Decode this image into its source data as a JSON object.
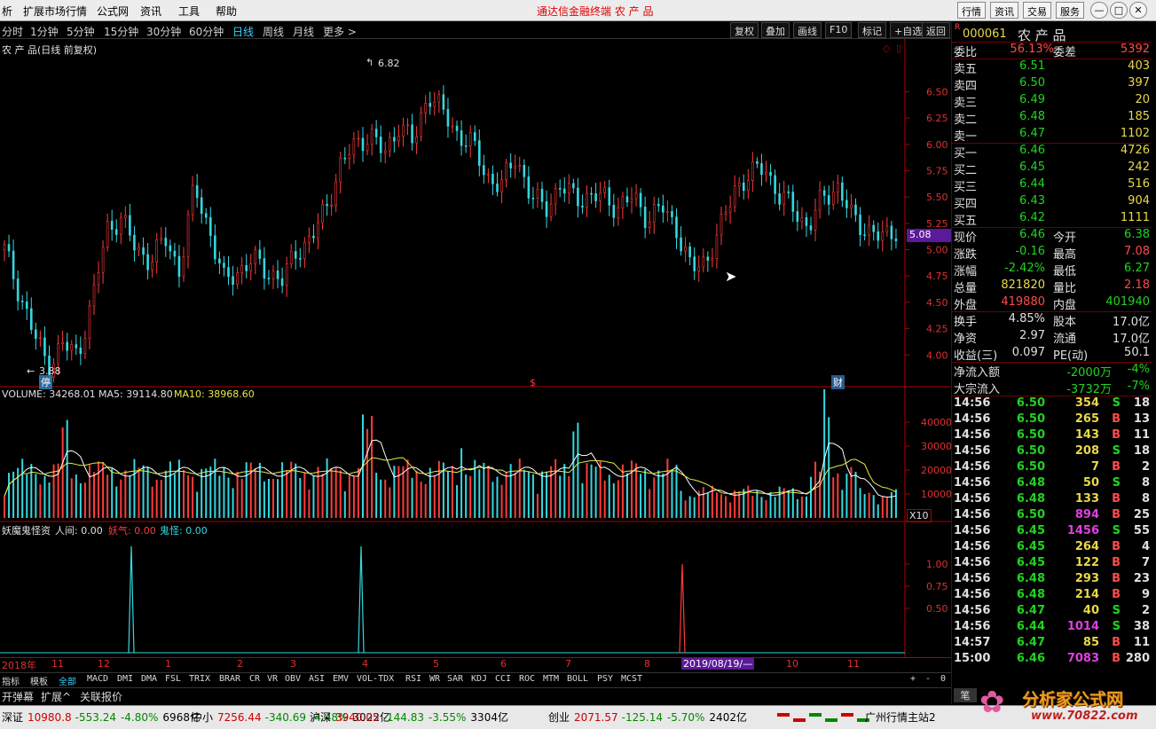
{
  "menubar": {
    "left_items": [
      "析",
      "扩展市场行情",
      "公式网",
      "资讯",
      "工具",
      "帮助"
    ],
    "title": "通达信金融终端  农 产 品",
    "right_buttons": [
      "行情",
      "资讯",
      "交易",
      "服务"
    ]
  },
  "toolbar": {
    "periods": [
      "分时",
      "1分钟",
      "5分钟",
      "15分钟",
      "30分钟",
      "60分钟",
      "日线",
      "周线",
      "月线",
      "更多 >"
    ],
    "active_period": "日线",
    "buttons": [
      "复权",
      "叠加",
      "画线",
      "F10",
      "标记",
      "+自选",
      "返回"
    ]
  },
  "chart": {
    "caption": "农 产 品(日线 前复权)",
    "high_mark": "6.82",
    "low_mark": "3.88",
    "price_badge": "5.08",
    "marker_stop": "停",
    "marker_dollar": "$",
    "marker_finance": "财",
    "volume_caption": {
      "label": "VOLUME: 34268.01",
      "ma5": "MA5: 39114.80",
      "ma10": "MA10: 38968.60"
    },
    "vol_scale": "X10",
    "indicator_caption": {
      "name": "妖魔鬼怪资",
      "renjian": "人间: 0.00",
      "yaoqi": "妖气: 0.00",
      "guiguai": "鬼怪: 0.00"
    },
    "date_axis": [
      "2018年",
      "11",
      "12",
      "1",
      "2",
      "3",
      "4",
      "5",
      "6",
      "7",
      "8",
      "2019/08/19/—",
      "10",
      "11"
    ]
  },
  "chart_data": [
    {
      "type": "candlestick",
      "title": "农 产 品(日线 前复权)",
      "y_ticks": [
        6.5,
        6.25,
        6.0,
        5.75,
        5.5,
        5.25,
        5.0,
        4.75,
        4.5,
        4.25,
        4.0
      ],
      "ylim": [
        3.8,
        6.9
      ],
      "close_path": [
        5.0,
        4.6,
        4.2,
        3.9,
        4.1,
        4.0,
        4.5,
        5.2,
        5.3,
        5.0,
        4.9,
        5.1,
        4.8,
        5.6,
        5.2,
        4.7,
        4.8,
        4.9,
        4.8,
        4.7,
        5.0,
        5.1,
        5.4,
        5.8,
        6.0,
        6.1,
        5.9,
        6.2,
        6.0,
        6.5,
        6.3,
        6.1,
        6.0,
        5.7,
        5.6,
        5.9,
        5.5,
        5.4,
        5.6,
        5.5,
        5.5,
        5.5,
        5.4,
        5.5,
        5.3,
        5.4,
        5.2,
        4.8,
        4.9,
        5.2,
        5.6,
        5.7,
        5.8,
        5.5,
        5.4,
        5.2,
        5.5,
        5.6,
        5.3,
        5.2,
        5.1,
        5.2
      ],
      "high": 6.82,
      "low": 3.88,
      "last": 5.08
    },
    {
      "type": "bar",
      "title": "VOLUME",
      "y_ticks": [
        40000,
        30000,
        20000,
        10000
      ],
      "ylim": [
        0,
        46000
      ],
      "volume": 34268.01,
      "ma5": 39114.8,
      "ma10": 38968.6
    },
    {
      "type": "line",
      "title": "妖魔鬼怪资",
      "y_ticks": [
        1.0,
        0.75,
        0.5
      ],
      "ylim": [
        0,
        1.3
      ],
      "spikes": [
        {
          "series": "鬼怪",
          "value": 1.2
        },
        {
          "series": "鬼怪",
          "value": 1.2
        },
        {
          "series": "妖气",
          "value": 1.0
        }
      ]
    }
  ],
  "tabs": [
    "指标",
    "模板",
    "全部",
    "MACD",
    "DMI",
    "DMA",
    "FSL",
    "TRIX",
    "BRAR",
    "CR",
    "VR",
    "OBV",
    "ASI",
    "EMV",
    "VOL-TDX",
    "RSI",
    "WR",
    "SAR",
    "KDJ",
    "CCI",
    "ROC",
    "MTM",
    "BOLL",
    "PSY",
    "MCST"
  ],
  "tab_ctrls": [
    "+",
    "-",
    "0"
  ],
  "bottom_buttons": [
    "开弹幕",
    "扩展^",
    "关联报价"
  ],
  "panel": {
    "code": "000061",
    "name": "农 产 品",
    "weibi_label": "委比",
    "weibi": "56.13%",
    "weicha_label": "委差",
    "weicha": "5392",
    "asks": [
      {
        "label": "卖五",
        "price": "6.51",
        "vol": "403"
      },
      {
        "label": "卖四",
        "price": "6.50",
        "vol": "397"
      },
      {
        "label": "卖三",
        "price": "6.49",
        "vol": "20"
      },
      {
        "label": "卖二",
        "price": "6.48",
        "vol": "185"
      },
      {
        "label": "卖一",
        "price": "6.47",
        "vol": "1102"
      }
    ],
    "bids": [
      {
        "label": "买一",
        "price": "6.46",
        "vol": "4726"
      },
      {
        "label": "买二",
        "price": "6.45",
        "vol": "242"
      },
      {
        "label": "买三",
        "price": "6.44",
        "vol": "516"
      },
      {
        "label": "买四",
        "price": "6.43",
        "vol": "904"
      },
      {
        "label": "买五",
        "price": "6.42",
        "vol": "1111"
      }
    ],
    "stats": [
      {
        "l1": "现价",
        "v1": "6.46",
        "c1": "green",
        "l2": "今开",
        "v2": "6.38",
        "c2": "green"
      },
      {
        "l1": "涨跌",
        "v1": "-0.16",
        "c1": "green",
        "l2": "最高",
        "v2": "7.08",
        "c2": "red"
      },
      {
        "l1": "涨幅",
        "v1": "-2.42%",
        "c1": "green",
        "l2": "最低",
        "v2": "6.27",
        "c2": "green"
      },
      {
        "l1": "总量",
        "v1": "821820",
        "c1": "yel",
        "l2": "量比",
        "v2": "2.18",
        "c2": "red"
      },
      {
        "l1": "外盘",
        "v1": "419880",
        "c1": "red",
        "l2": "内盘",
        "v2": "401940",
        "c2": "green"
      }
    ],
    "stats2": [
      {
        "l1": "换手",
        "v1": "4.85%",
        "l2": "股本",
        "v2": "17.0亿"
      },
      {
        "l1": "净资",
        "v1": "2.97",
        "l2": "流通",
        "v2": "17.0亿"
      },
      {
        "l1": "收益(三)",
        "v1": "0.097",
        "l2": "PE(动)",
        "v2": "50.1"
      }
    ],
    "flow": [
      {
        "label": "净流入额",
        "value": "-2000万",
        "pct": "-4%"
      },
      {
        "label": "大宗流入",
        "value": "-3732万",
        "pct": "-7%"
      }
    ],
    "ticks": [
      {
        "time": "14:56",
        "price": "6.50",
        "pc": "green",
        "vol": "354",
        "vc": "yel",
        "bs": "S",
        "n": "18"
      },
      {
        "time": "14:56",
        "price": "6.50",
        "pc": "green",
        "vol": "265",
        "vc": "yel",
        "bs": "B",
        "n": "13"
      },
      {
        "time": "14:56",
        "price": "6.50",
        "pc": "green",
        "vol": "143",
        "vc": "yel",
        "bs": "B",
        "n": "11"
      },
      {
        "time": "14:56",
        "price": "6.50",
        "pc": "green",
        "vol": "208",
        "vc": "yel",
        "bs": "S",
        "n": "18"
      },
      {
        "time": "14:56",
        "price": "6.50",
        "pc": "green",
        "vol": "7",
        "vc": "yel",
        "bs": "B",
        "n": "2"
      },
      {
        "time": "14:56",
        "price": "6.48",
        "pc": "green",
        "vol": "50",
        "vc": "yel",
        "bs": "S",
        "n": "8"
      },
      {
        "time": "14:56",
        "price": "6.48",
        "pc": "green",
        "vol": "133",
        "vc": "yel",
        "bs": "B",
        "n": "8"
      },
      {
        "time": "14:56",
        "price": "6.50",
        "pc": "green",
        "vol": "894",
        "vc": "mag",
        "bs": "B",
        "n": "25"
      },
      {
        "time": "14:56",
        "price": "6.45",
        "pc": "green",
        "vol": "1456",
        "vc": "mag",
        "bs": "S",
        "n": "55"
      },
      {
        "time": "14:56",
        "price": "6.45",
        "pc": "green",
        "vol": "264",
        "vc": "yel",
        "bs": "B",
        "n": "4"
      },
      {
        "time": "14:56",
        "price": "6.45",
        "pc": "green",
        "vol": "122",
        "vc": "yel",
        "bs": "B",
        "n": "7"
      },
      {
        "time": "14:56",
        "price": "6.48",
        "pc": "green",
        "vol": "293",
        "vc": "yel",
        "bs": "B",
        "n": "23"
      },
      {
        "time": "14:56",
        "price": "6.48",
        "pc": "green",
        "vol": "214",
        "vc": "yel",
        "bs": "B",
        "n": "9"
      },
      {
        "time": "14:56",
        "price": "6.47",
        "pc": "green",
        "vol": "40",
        "vc": "yel",
        "bs": "S",
        "n": "2"
      },
      {
        "time": "14:56",
        "price": "6.44",
        "pc": "green",
        "vol": "1014",
        "vc": "mag",
        "bs": "S",
        "n": "38"
      },
      {
        "time": "14:57",
        "price": "6.47",
        "pc": "green",
        "vol": "85",
        "vc": "yel",
        "bs": "B",
        "n": "11"
      },
      {
        "time": "15:00",
        "price": "6.46",
        "pc": "green",
        "vol": "7083",
        "vc": "mag",
        "bs": "B",
        "n": "280"
      }
    ],
    "bottom_tab": "笔"
  },
  "status": {
    "items": [
      {
        "name": "深证",
        "value": "10980.8",
        "chg": "-553.24",
        "pct": "-4.80%",
        "amt": "6968亿"
      },
      {
        "name": "中小",
        "value": "7256.44",
        "chg": "-340.69",
        "pct": "-4.48%",
        "amt": "3022亿"
      },
      {
        "name": "沪深",
        "value": "3940.05",
        "chg": "-144.83",
        "pct": "-3.55%",
        "amt": "3304亿"
      },
      {
        "name": "创业",
        "value": "2071.57",
        "chg": "-125.14",
        "pct": "-5.70%",
        "amt": "2402亿"
      }
    ],
    "server": "广州行情主站2",
    "logo": "分析家公式网",
    "logo_url": "www.70822.com"
  },
  "colors": {
    "up": "#ff3b3b",
    "down": "#35d8e0",
    "ma5": "#ffffff",
    "ma10": "#e8e84a",
    "axis": "#b00000"
  }
}
